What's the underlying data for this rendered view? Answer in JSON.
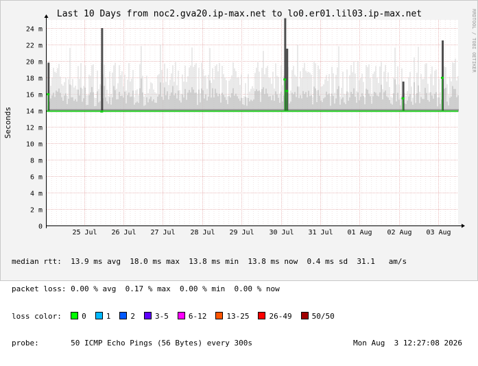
{
  "chart_data": {
    "type": "area",
    "title": "Last 10 Days from noc2.gva20.ip-max.net to lo0.er01.lil03.ip-max.net",
    "ylabel": "Seconds",
    "xlabel": "",
    "side_label": "RRDTOOL / TOBI OETIKER",
    "ylim": [
      0,
      0.025
    ],
    "y_ticks": [
      0,
      0.002,
      0.004,
      0.006,
      0.008,
      0.01,
      0.012,
      0.014,
      0.016,
      0.018,
      0.02,
      0.022,
      0.024
    ],
    "y_tick_labels": [
      "0",
      "2 m",
      "4 m",
      "6 m",
      "8 m",
      "10 m",
      "12 m",
      "14 m",
      "16 m",
      "18 m",
      "20 m",
      "22 m",
      "24 m"
    ],
    "x_range_days": [
      0,
      10.45
    ],
    "x_ticks": [
      0.95,
      1.95,
      2.95,
      3.95,
      4.95,
      5.95,
      6.95,
      7.95,
      8.95,
      9.95
    ],
    "x_tick_labels": [
      "25 Jul",
      "26 Jul",
      "27 Jul",
      "28 Jul",
      "29 Jul",
      "30 Jul",
      "31 Jul",
      "01 Aug",
      "02 Aug",
      "03 Aug"
    ],
    "grid": true,
    "median_rtt_baseline": 0.0139,
    "spikes": [
      {
        "x": 0.04,
        "median": 0.016,
        "peak": 0.0198
      },
      {
        "x": 1.4,
        "median": 0.0139,
        "peak": 0.024
      },
      {
        "x": 6.05,
        "median": 0.0178,
        "peak": 0.0252
      },
      {
        "x": 6.1,
        "median": 0.0164,
        "peak": 0.0215
      },
      {
        "x": 9.05,
        "median": 0.0155,
        "peak": 0.0175
      },
      {
        "x": 10.05,
        "median": 0.018,
        "peak": 0.0225
      }
    ],
    "series": [
      {
        "values": [
          0.0139,
          0.0139,
          0.0139,
          0.0139,
          0.0139,
          0.0139,
          0.0139,
          0.0139,
          0.0139,
          0.0139,
          0.0139
        ]
      }
    ],
    "colors": {
      "median": "#20d020",
      "loss_marker": "#00d000",
      "smoke_dark": "#303030",
      "grid": "#e8b8b8",
      "axis": "#000000",
      "plot_bg": "#ffffff",
      "canvas_bg": "#f3f3f3"
    }
  },
  "stats": {
    "median_rtt_label": "median rtt:",
    "median_rtt_values": "13.9 ms avg  18.0 ms max  13.8 ms min  13.8 ms now  0.4 ms sd  31.1   am/s",
    "packet_loss_label": "packet loss:",
    "packet_loss_values": "0.00 % avg  0.17 % max  0.00 % min  0.00 % now",
    "loss_color_label": "loss color:",
    "loss_colors": [
      {
        "label": "0",
        "color": "#00ff00"
      },
      {
        "label": "1",
        "color": "#00b8ff"
      },
      {
        "label": "2",
        "color": "#0059ff"
      },
      {
        "label": "3-5",
        "color": "#5e00ff"
      },
      {
        "label": "6-12",
        "color": "#ff00fe"
      },
      {
        "label": "13-25",
        "color": "#ff5500"
      },
      {
        "label": "26-49",
        "color": "#ff0000"
      },
      {
        "label": "50/50",
        "color": "#a10000"
      }
    ],
    "probe_label": "probe:",
    "probe_value": "50 ICMP Echo Pings (56 Bytes) every 300s",
    "timestamp": "Mon Aug  3 12:27:08 2026"
  }
}
